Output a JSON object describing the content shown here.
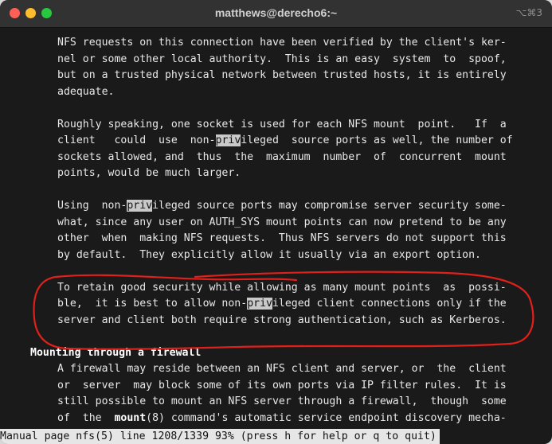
{
  "window": {
    "title": "matthews@derecho6:~",
    "shortcut": "⌥⌘3"
  },
  "terminal": {
    "para1": [
      "NFS requests on this connection have been verified by the client's ker-",
      "nel or some other local authority.  This is an easy  system  to  spoof,",
      "but on a trusted physical network between trusted hosts, it is entirely",
      "adequate."
    ],
    "para2": {
      "l1": "Roughly speaking, one socket is used for each NFS mount  point.   If  a",
      "l2a": "client   could  use  non-",
      "l2hl": "priv",
      "l2b": "ileged  source ports as well, the number of",
      "l3": "sockets allowed, and  thus  the  maximum  number  of  concurrent  mount",
      "l4": "points, would be much larger."
    },
    "para3": {
      "l1a": "Using  non-",
      "l1hl": "priv",
      "l1b": "ileged source ports may compromise server security some-",
      "l2": "what, since any user on AUTH_SYS mount points can now pretend to be any",
      "l3": "other  when  making NFS requests.  Thus NFS servers do not support this",
      "l4": "by default.  They explicitly allow it usually via an export option."
    },
    "para4": {
      "l1": "To retain good security while allowing as many mount points  as  possi-",
      "l2a": "ble,  it is best to allow non-",
      "l2hl": "priv",
      "l2b": "ileged client connections only if the",
      "l3": "server and client both require strong authentication, such as Kerberos."
    },
    "section_heading": "Mounting through a firewall",
    "para5": {
      "l1": "A firewall may reside between an NFS client and server, or  the  client",
      "l2": "or  server  may block some of its own ports via IP filter rules.  It is",
      "l3": "still possible to mount an NFS server through a firewall,  though  some",
      "l4a": "of  the  ",
      "l4bold": "mount",
      "l4b": "(8) command's automatic service endpoint discovery mecha-"
    },
    "status_line": "Manual page nfs(5) line 1208/1339 93% (press h for help or q to quit)"
  },
  "colors": {
    "background": "#1a1a1a",
    "text": "#e8e8e8",
    "highlight": "#c9c9c9",
    "annotation": "#e0201a"
  }
}
